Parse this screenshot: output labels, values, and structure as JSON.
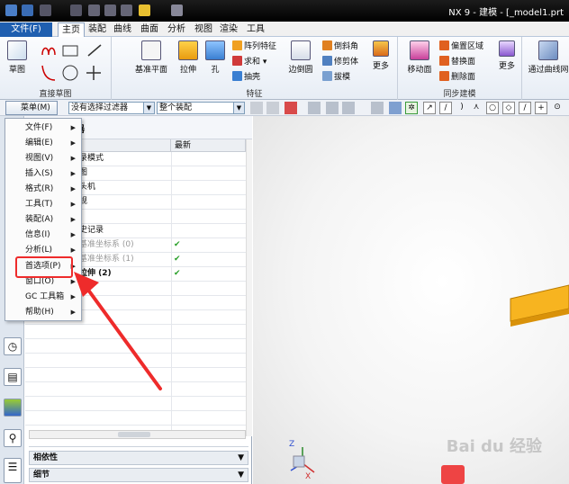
{
  "window": {
    "title": "NX 9 - 建模 - [_model1.prt"
  },
  "menubar": {
    "file": "文件(F)",
    "tabs": [
      "主页",
      "装配",
      "曲线",
      "曲面",
      "分析",
      "视图",
      "渲染",
      "工具"
    ],
    "active": "主页"
  },
  "ribbon": {
    "sketch": "草图",
    "direct_sketch": "直接草图",
    "datum_plane": "基准平面",
    "extrude": "拉伸",
    "hole": "孔",
    "pattern": "阵列特征",
    "unite": "求和",
    "shell": "抽壳",
    "edge_blend": "边倒圆",
    "chamfer": "倒斜角",
    "trim_body": "修剪体",
    "draft": "拔模",
    "more1": "更多",
    "features_group": "特征",
    "move_face": "移动面",
    "offset_region": "偏置区域",
    "replace_face": "替换面",
    "delete_face": "删除面",
    "sync_group": "同步建模",
    "more2": "更多",
    "through_curve_mesh": "通过曲线网"
  },
  "filterbar": {
    "menu_label": "菜单(M)",
    "filter": "没有选择过滤器",
    "assembly": "整个装配"
  },
  "navigator": {
    "title": "部件导航器",
    "title_visible": "器",
    "col_name": "名称",
    "col_latest": "最新",
    "rows": [
      {
        "name": "录模式",
        "latest": ""
      },
      {
        "name": "图",
        "latest": ""
      },
      {
        "name": "头机",
        "latest": ""
      },
      {
        "name": "规",
        "latest": ""
      },
      {
        "name": "",
        "latest": ""
      },
      {
        "name": "史记录",
        "latest": ""
      },
      {
        "name": "基准坐标系 (0)",
        "latest": "✔"
      },
      {
        "name": "基准坐标系 (1)",
        "latest": "✔"
      },
      {
        "name": "拉伸 (2)",
        "latest": "✔"
      }
    ],
    "dependencies": "相依性",
    "details": "细节"
  },
  "dropdown_menu": {
    "items": [
      "文件(F)",
      "编辑(E)",
      "视图(V)",
      "插入(S)",
      "格式(R)",
      "工具(T)",
      "装配(A)",
      "信息(I)",
      "分析(L)",
      "首选项(P)",
      "窗口(O)",
      "GC 工具箱",
      "帮助(H)"
    ],
    "highlighted": "首选项(P)"
  },
  "watermark": "Bai du 经验",
  "colors": {
    "accent_red": "#ee2b2b",
    "active_tab": "#ffffff",
    "part_orange": "#f7b420",
    "check_green": "#2aa02a"
  }
}
